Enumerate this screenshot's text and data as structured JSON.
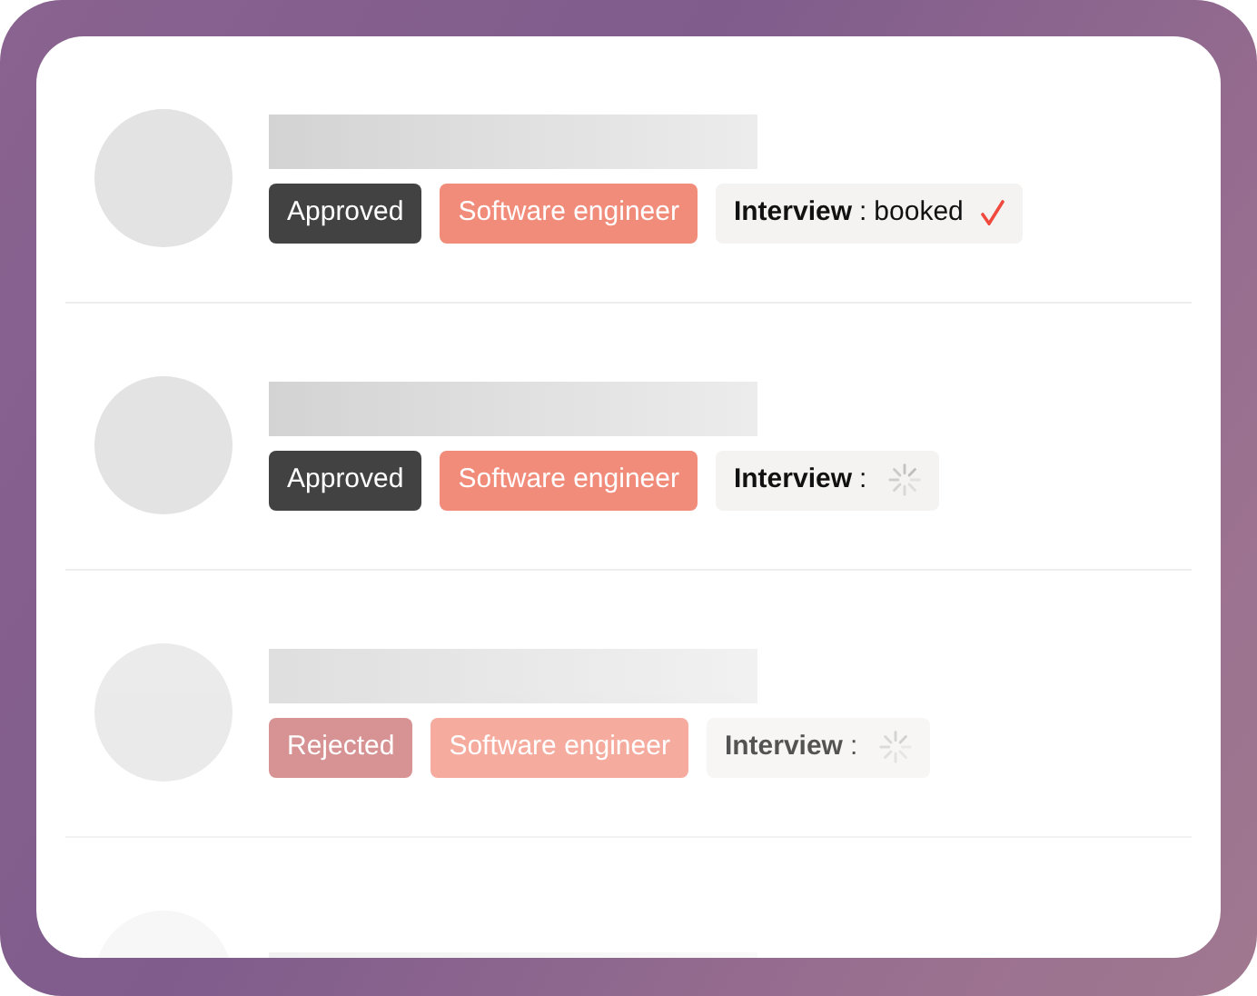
{
  "candidates": [
    {
      "kind": "entry",
      "dimmed": false,
      "status": {
        "label": "Approved",
        "kind": "approved"
      },
      "role": "Software engineer",
      "interview": {
        "label": "Interview",
        "separator": ":",
        "value": "booked",
        "kind": "booked"
      }
    },
    {
      "kind": "entry",
      "dimmed": false,
      "status": {
        "label": "Approved",
        "kind": "approved"
      },
      "role": "Software engineer",
      "interview": {
        "label": "Interview",
        "separator": ":",
        "kind": "pending"
      }
    },
    {
      "kind": "entry",
      "dimmed": true,
      "status": {
        "label": "Rejected",
        "kind": "rejected"
      },
      "role": "Software engineer",
      "interview": {
        "label": "Interview",
        "separator": ":",
        "kind": "pending"
      }
    },
    {
      "kind": "placeholder"
    }
  ]
}
